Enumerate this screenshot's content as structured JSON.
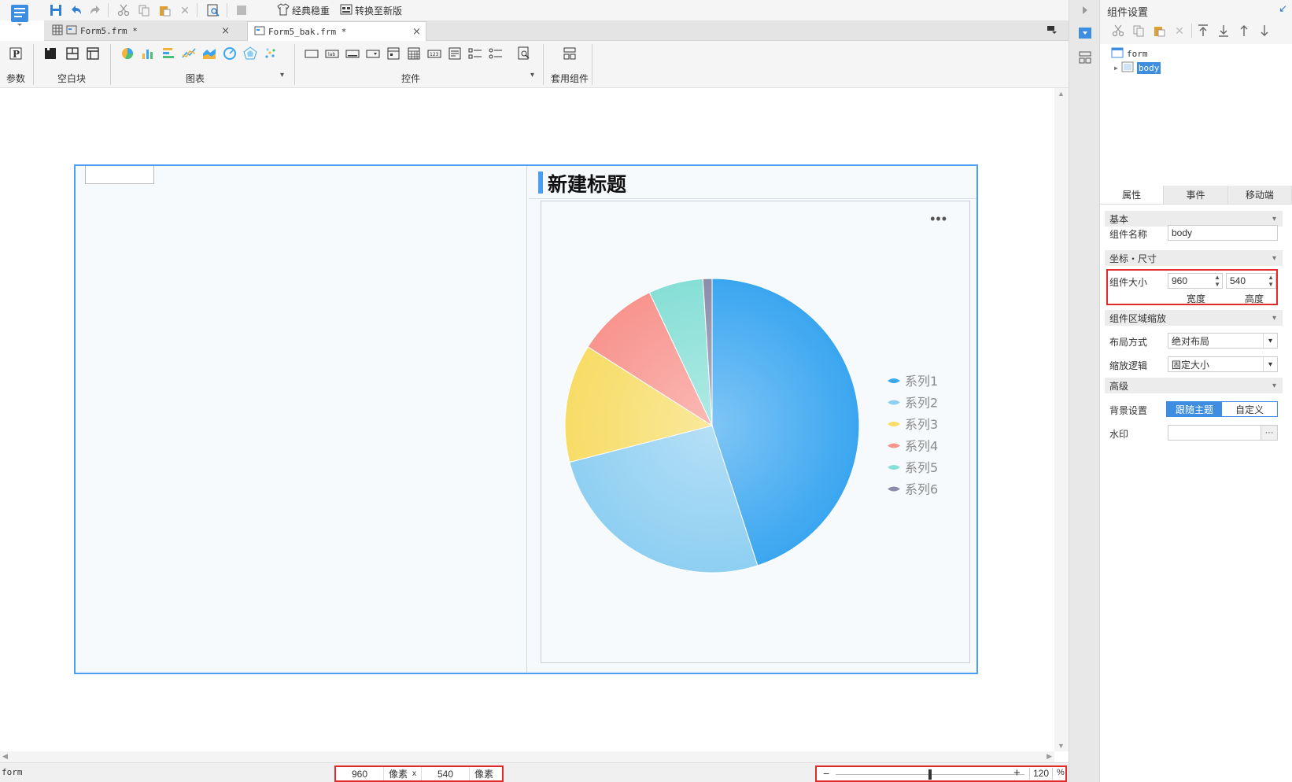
{
  "toolbar": {
    "classic_label": "经典稳重",
    "convert_label": "转换至新版"
  },
  "tabs": [
    {
      "label": "Form5.frm *",
      "close": "×"
    },
    {
      "label": "Form5_bak.frm *",
      "close": "×"
    }
  ],
  "ribbon": {
    "param_label": "参数",
    "blank_label": "空白块",
    "chart_label": "图表",
    "control_label": "控件",
    "template_label": "套用组件"
  },
  "canvas": {
    "chart_title": "新建标题",
    "more_label": "•••"
  },
  "chart_data": {
    "type": "pie",
    "categories": [
      "系列1",
      "系列2",
      "系列3",
      "系列4",
      "系列5",
      "系列6"
    ],
    "values": [
      45,
      26,
      13,
      9,
      6,
      1
    ],
    "colors": [
      "#3aa6f0",
      "#8ecff2",
      "#f7dc66",
      "#f8948e",
      "#86dfd6",
      "#8c8ca8"
    ],
    "legend_position": "right"
  },
  "status": {
    "form_label": "form",
    "width_value": "960",
    "width_unit": "像素",
    "times": "x",
    "height_value": "540",
    "height_unit": "像素",
    "zoom_minus": "−",
    "zoom_plus": "+",
    "zoom_value": "120",
    "zoom_pct": "%",
    "zoom_level": 0.5
  },
  "panel": {
    "title": "组件设置",
    "tree": {
      "root": "form",
      "child": "body"
    },
    "tabs": [
      "属性",
      "事件",
      "移动端"
    ],
    "sections": {
      "basic": "基本",
      "coord": "坐标・尺寸",
      "scale": "组件区域缩放",
      "advanced": "高级"
    },
    "fields": {
      "name_label": "组件名称",
      "name_value": "body",
      "size_label": "组件大小",
      "width_value": "960",
      "height_value": "540",
      "width_caption": "宽度",
      "height_caption": "高度",
      "layout_label": "布局方式",
      "layout_value": "绝对布局",
      "scale_label": "缩放逻辑",
      "scale_value": "固定大小",
      "bg_label": "背景设置",
      "bg_follow": "跟随主题",
      "bg_custom": "自定义",
      "watermark_label": "水印",
      "watermark_btn": "···"
    }
  }
}
